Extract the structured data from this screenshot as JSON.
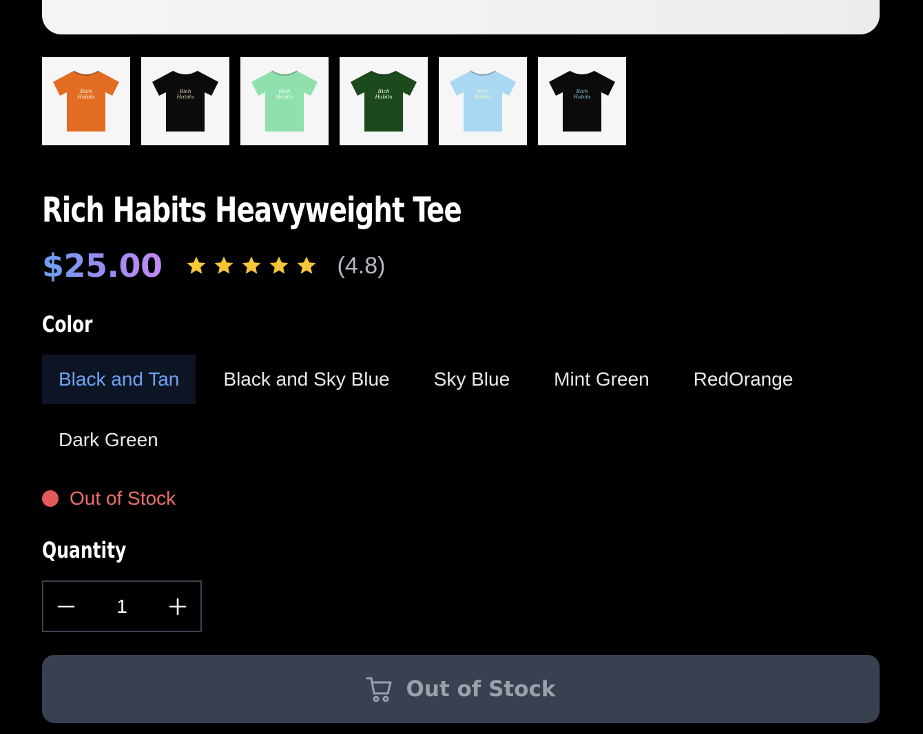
{
  "product": {
    "title": "Rich Habits Heavyweight Tee",
    "price": "$25.00",
    "rating": "(4.8)",
    "star_count": 5,
    "star_color": "#f5c53a",
    "price_gradient": [
      "#6aa0f2",
      "#c58af5"
    ]
  },
  "thumbnails": [
    {
      "shirt_color": "#e26d22",
      "print_text": "Rich Habits",
      "print_color": "#ffffff"
    },
    {
      "shirt_color": "#0b0b0b",
      "print_text": "Rich Habits",
      "print_color": "#e8d6b0"
    },
    {
      "shirt_color": "#8fe0ac",
      "print_text": "Rich Habits",
      "print_color": "#ffffff"
    },
    {
      "shirt_color": "#1c4a1c",
      "print_text": "Rich Habits",
      "print_color": "#ffffff"
    },
    {
      "shirt_color": "#a9d8f2",
      "print_text": "Rich Habits",
      "print_color": "#fff6c8"
    },
    {
      "shirt_color": "#0b0b0b",
      "print_text": "Rich Habits",
      "print_color": "#8cc9ee"
    }
  ],
  "color": {
    "label": "Color",
    "options": [
      "Black and Tan",
      "Black and Sky Blue",
      "Sky Blue",
      "Mint Green",
      "RedOrange",
      "Dark Green"
    ],
    "selected": "Black and Tan"
  },
  "stock": {
    "text": "Out of Stock",
    "dot_color": "#e45a5a"
  },
  "quantity": {
    "label": "Quantity",
    "value": "1"
  },
  "cart_button": {
    "label": "Out of Stock",
    "icon": "cart-icon"
  }
}
